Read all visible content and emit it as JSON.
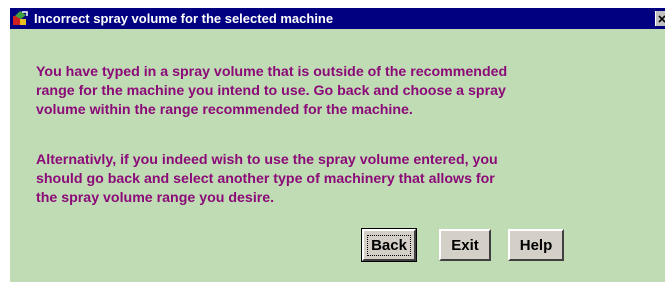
{
  "window": {
    "title": "Incorrect spray volume for the selected machine",
    "icon": "app-icon",
    "close_icon": "close-icon"
  },
  "message": {
    "paragraph1": [
      "You have typed in a spray volume that is outside of the recommended",
      "range for the machine you intend to use.  Go back and choose a spray",
      "volume within the range recommended for the machine."
    ],
    "paragraph2": [
      "Alternativly, if you indeed wish to use the spray volume entered, you",
      "should go back and select another type of machinery that allows for",
      "the spray volume range you desire."
    ]
  },
  "buttons": {
    "back_label": "Back",
    "exit_label": "Exit",
    "help_label": "Help"
  },
  "colors": {
    "titlebar": "#000080",
    "body_background": "#c0dcb4",
    "message_text": "#8b0a78",
    "button_face": "#d4d0c8"
  }
}
